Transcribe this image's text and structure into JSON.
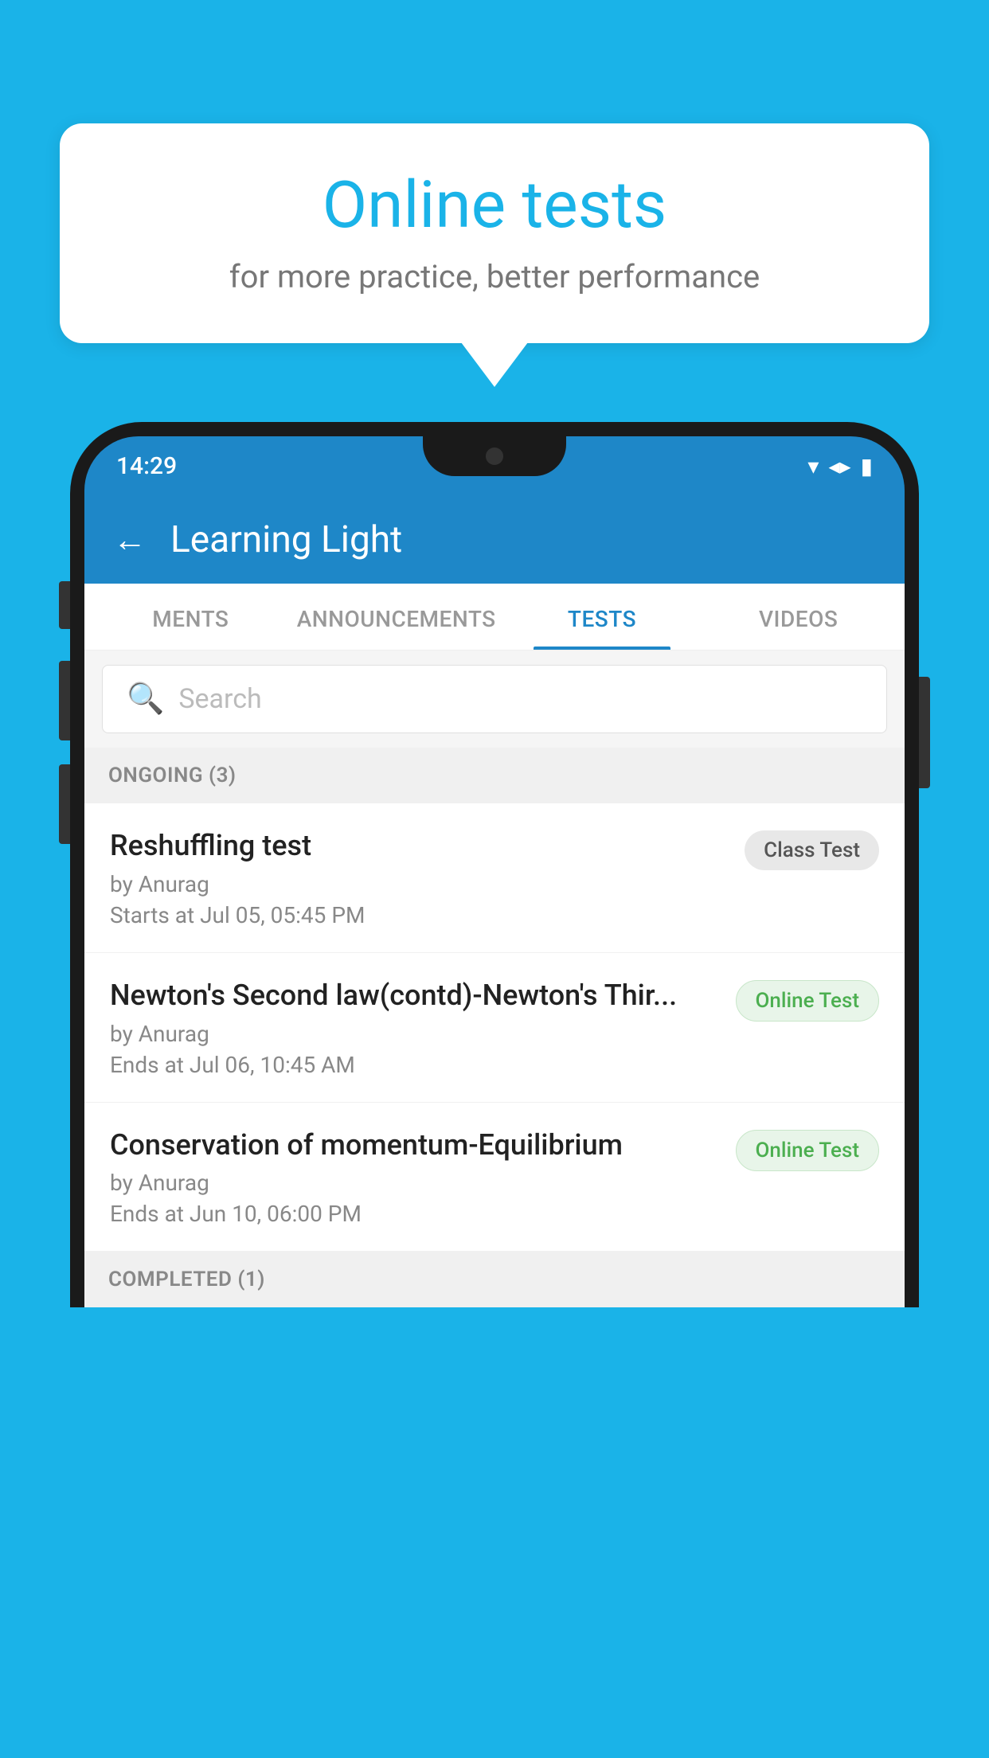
{
  "background": {
    "color": "#1ab3e8"
  },
  "speech_bubble": {
    "title": "Online tests",
    "subtitle": "for more practice, better performance"
  },
  "phone": {
    "status_bar": {
      "time": "14:29",
      "wifi": "▼",
      "signal": "▲",
      "battery": "▮"
    },
    "header": {
      "back_label": "←",
      "title": "Learning Light"
    },
    "tabs": [
      {
        "label": "MENTS",
        "active": false
      },
      {
        "label": "ANNOUNCEMENTS",
        "active": false
      },
      {
        "label": "TESTS",
        "active": true
      },
      {
        "label": "VIDEOS",
        "active": false
      }
    ],
    "search": {
      "placeholder": "Search"
    },
    "sections": [
      {
        "header": "ONGOING (3)",
        "items": [
          {
            "name": "Reshuffling test",
            "author": "by Anurag",
            "date": "Starts at  Jul 05, 05:45 PM",
            "badge": "Class Test",
            "badge_type": "class"
          },
          {
            "name": "Newton's Second law(contd)-Newton's Thir...",
            "author": "by Anurag",
            "date": "Ends at  Jul 06, 10:45 AM",
            "badge": "Online Test",
            "badge_type": "online"
          },
          {
            "name": "Conservation of momentum-Equilibrium",
            "author": "by Anurag",
            "date": "Ends at  Jun 10, 06:00 PM",
            "badge": "Online Test",
            "badge_type": "online"
          }
        ]
      },
      {
        "header": "COMPLETED (1)",
        "items": []
      }
    ]
  }
}
